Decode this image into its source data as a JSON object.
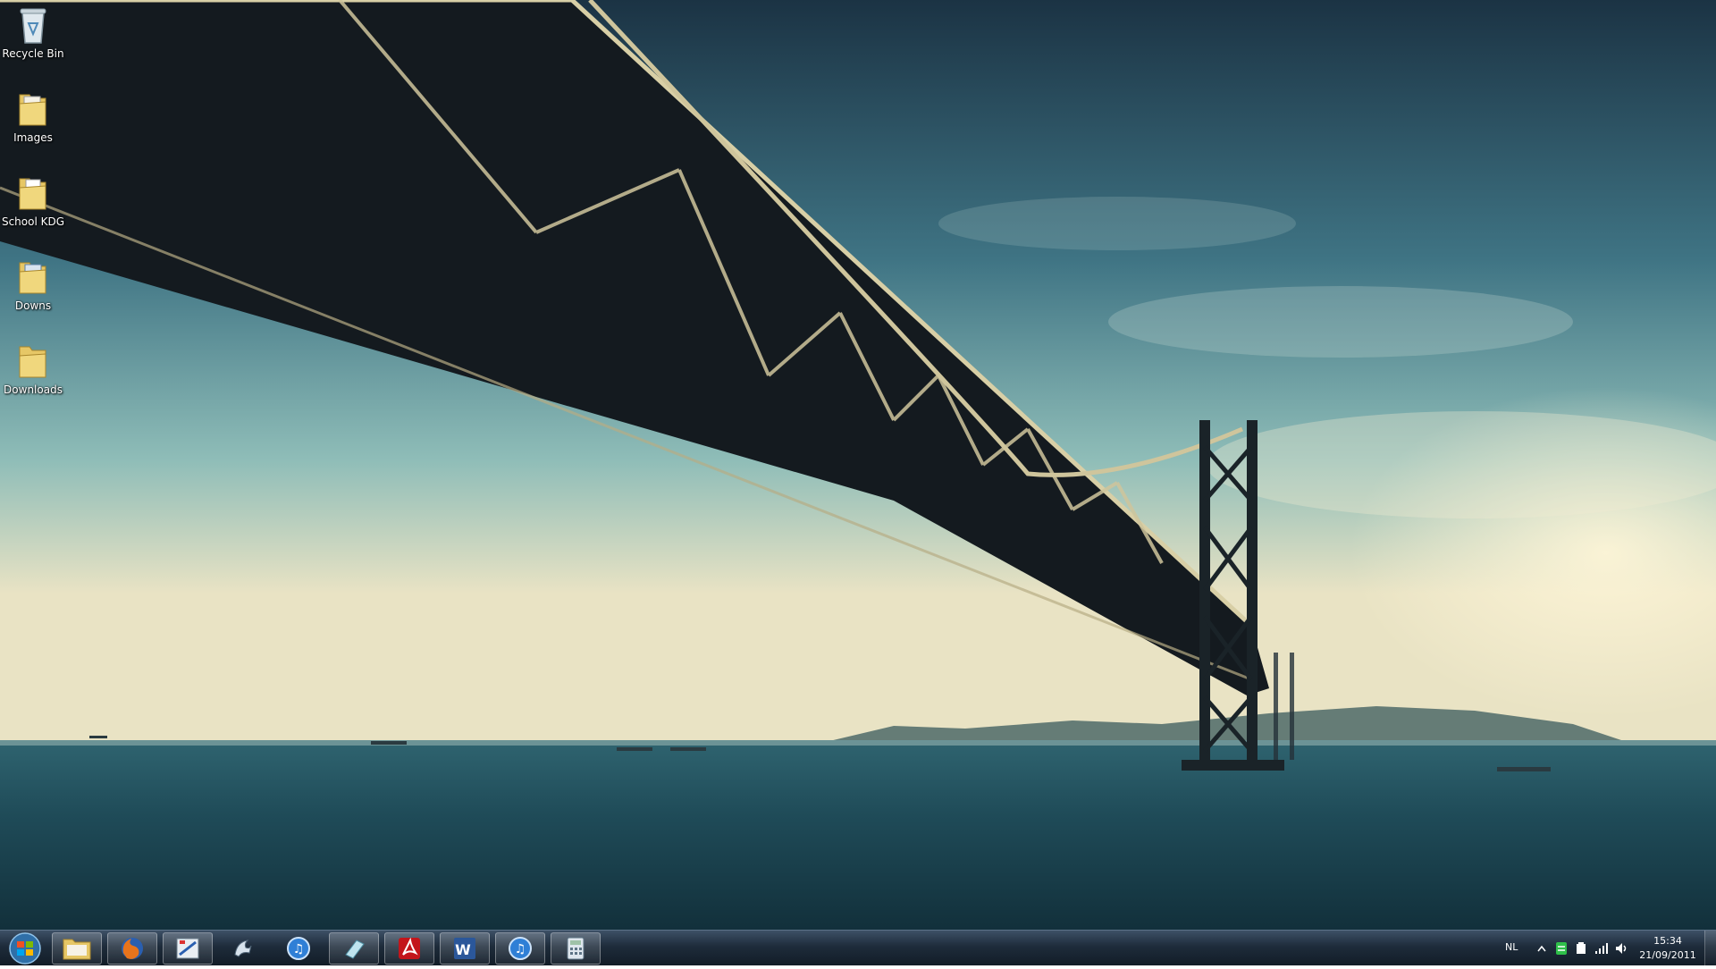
{
  "desktop": {
    "icons": [
      {
        "label": "Recycle Bin",
        "icon": "recycle-bin-icon"
      },
      {
        "label": "Images",
        "icon": "folder-icon"
      },
      {
        "label": "School KDG",
        "icon": "folder-icon"
      },
      {
        "label": "Downs",
        "icon": "folder-icon"
      },
      {
        "label": "Downloads",
        "icon": "folder-icon"
      }
    ]
  },
  "taskbar": {
    "start": {
      "icon": "windows-logo-icon"
    },
    "apps": [
      {
        "name": "Windows Explorer",
        "icon": "folder-icon",
        "open": true
      },
      {
        "name": "Firefox",
        "icon": "firefox-icon",
        "open": true
      },
      {
        "name": "Paint",
        "icon": "paint-icon",
        "open": true
      },
      {
        "name": "Dolphin",
        "icon": "dolphin-icon",
        "open": false
      },
      {
        "name": "iTunes",
        "icon": "itunes-icon",
        "open": false
      },
      {
        "name": "Notepad",
        "icon": "eraser-icon",
        "open": true
      },
      {
        "name": "Adobe Reader",
        "icon": "acrobat-icon",
        "open": true
      },
      {
        "name": "Microsoft Word",
        "icon": "word-icon",
        "open": true
      },
      {
        "name": "iTunes",
        "icon": "itunes-icon",
        "open": true
      },
      {
        "name": "Calculator",
        "icon": "calculator-icon",
        "open": true
      }
    ],
    "tray": {
      "language": "NL",
      "time": "15:34",
      "date": "21/09/2011"
    }
  },
  "colors": {
    "sky_top": "#1d3a4d",
    "sky_mid": "#4e8a97",
    "horizon": "#e8e2c2",
    "sea": "#1f4b58",
    "bridge": "#141a1f"
  }
}
